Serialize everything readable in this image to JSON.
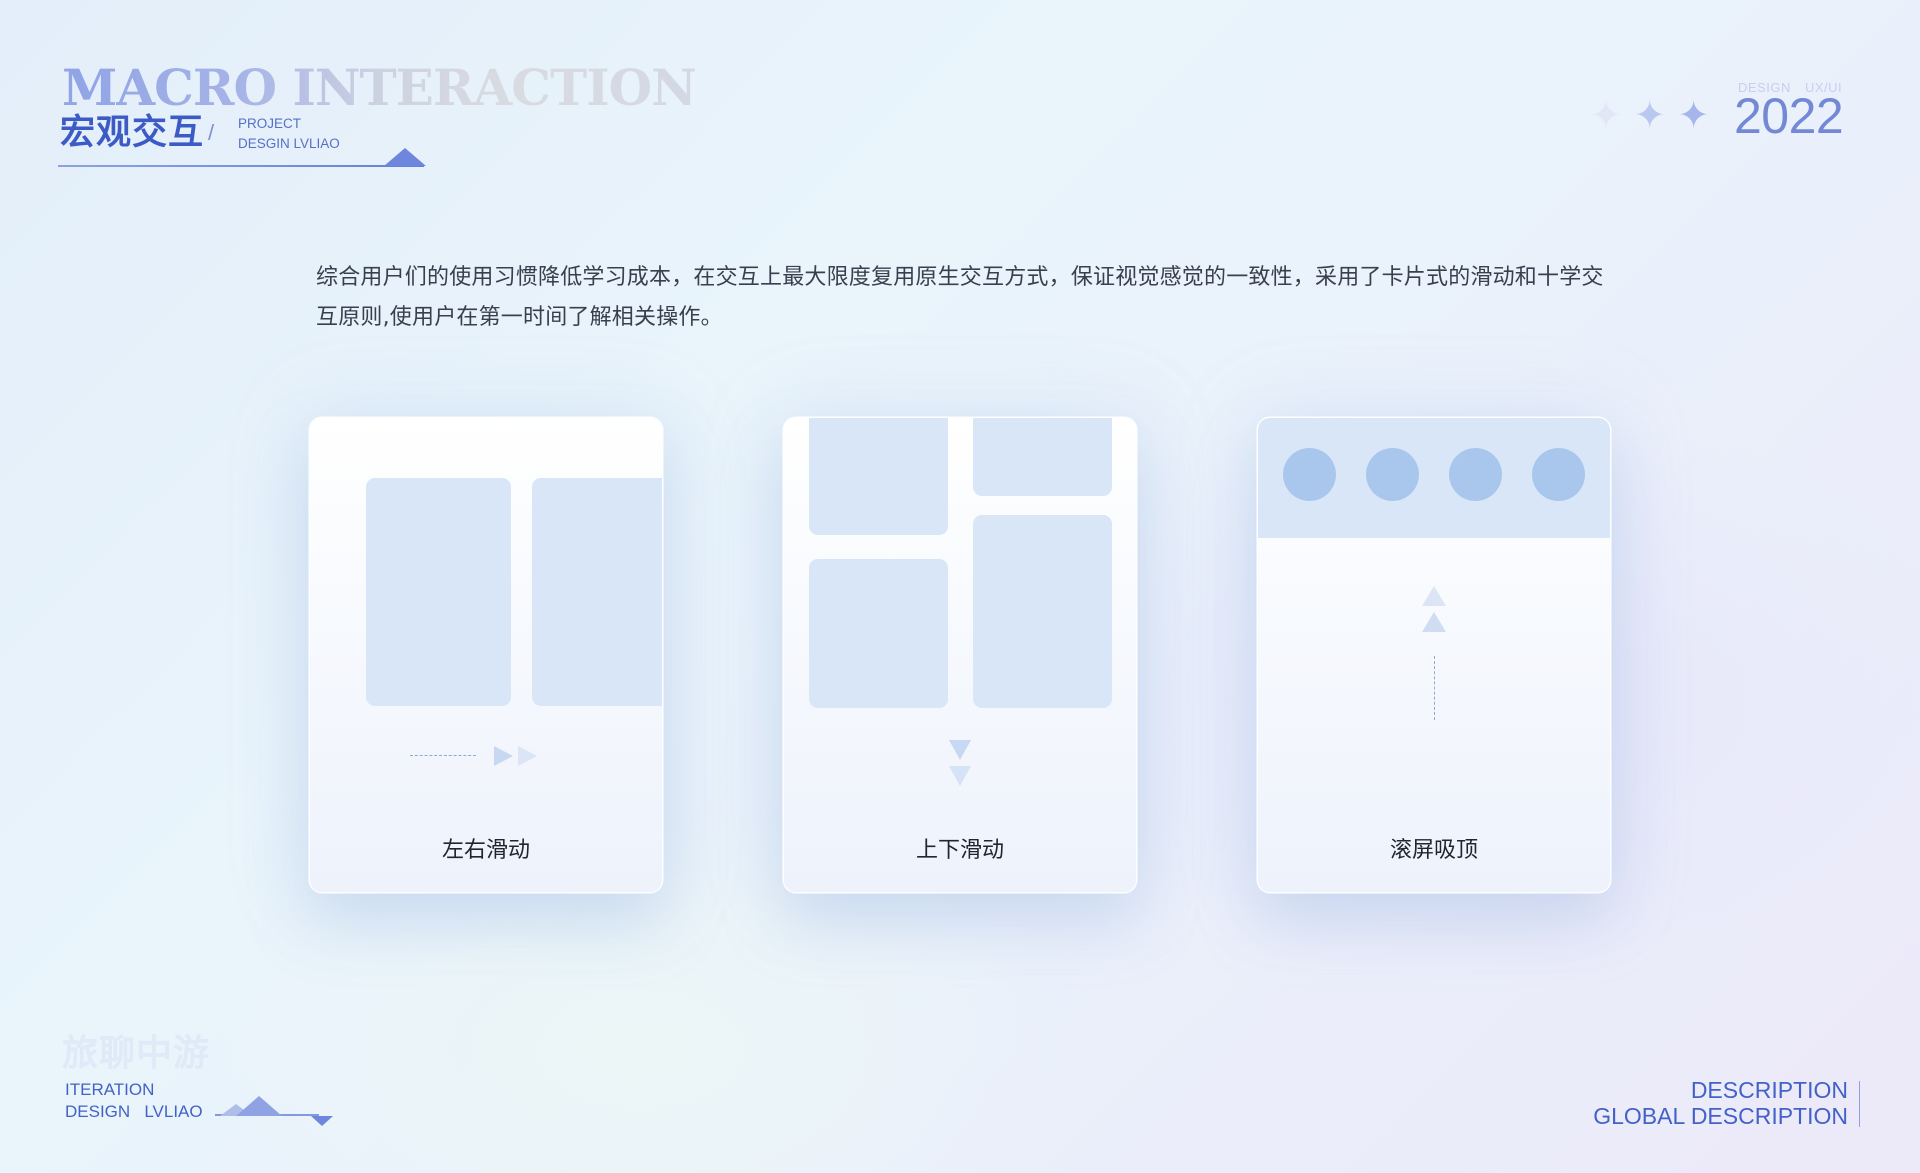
{
  "header": {
    "title_en": "MACRO INTERACTION",
    "title_cn": "宏观交互",
    "slash": "/",
    "project_line1": "PROJECT",
    "project_line2": "DESGIN LVLIAO",
    "design_small": "DESIGN UX/UI",
    "year": "2022",
    "stars": [
      "✦",
      "✦",
      "✦"
    ]
  },
  "description": "综合用户们的使用习惯降低学习成本，在交互上最大限度复用原生交互方式，保证视觉感觉的一致性，采用了卡片式的滑动和十学交互原则,使用户在第一时间了解相关操作。",
  "cards": [
    {
      "label": "左右滑动"
    },
    {
      "label": "上下滑动"
    },
    {
      "label": "滚屏吸顶"
    }
  ],
  "footer": {
    "left_cn": "旅聊中游",
    "left_line1": "ITERATION",
    "left_line2": "DESIGN   LVLIAO",
    "right_line1": "DESCRIPTION",
    "right_line2": "GLOBAL DESCRIPTION"
  },
  "colors": {
    "accent": "#3d5bc6",
    "block": "#d8e6f7",
    "circle": "#a9c7ec",
    "text": "#3a3f4f"
  }
}
